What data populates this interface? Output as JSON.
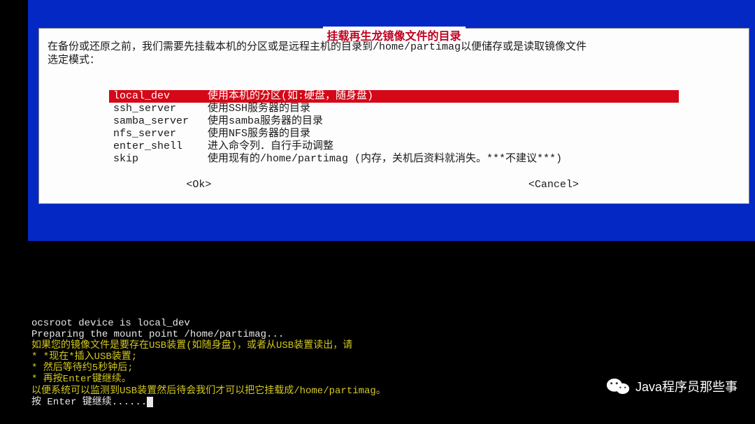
{
  "dialog": {
    "title": "挂载再生龙镜像文件的目录",
    "instructions_line1": "在备份或还原之前，我们需要先挂载本机的分区或是远程主机的目录到/home/partimag以便储存或是读取镜像文件",
    "instructions_line2": "选定模式：",
    "menu": [
      {
        "key": "local_dev",
        "desc": "使用本机的分区(如:硬盘，随身盘)",
        "selected": true
      },
      {
        "key": "ssh_server",
        "desc": "使用SSH服务器的目录",
        "selected": false
      },
      {
        "key": "samba_server",
        "desc": "使用samba服务器的目录",
        "selected": false
      },
      {
        "key": "nfs_server",
        "desc": "使用NFS服务器的目录",
        "selected": false
      },
      {
        "key": "enter_shell",
        "desc": "进入命令列．自行手动调整",
        "selected": false
      },
      {
        "key": "skip",
        "desc": "使用现有的/home/partimag (内存，关机后资料就消失。***不建议***)",
        "selected": false
      }
    ],
    "ok_label": "<Ok>",
    "cancel_label": "<Cancel>"
  },
  "terminal": {
    "line1": "ocsroot device is local_dev",
    "line2": "Preparing the mount point /home/partimag...",
    "line3": "如果您的镜像文件是要存在USB装置(如随身盘)，或者从USB装置读出，请",
    "line4": "* *现在*插入USB装置;",
    "line5": "* 然后等待约5秒钟后;",
    "line6": "* 再按Enter键继续。",
    "line7": "以便系统可以监测到USB装置然后待会我们才可以把它挂载成/home/partimag。",
    "line8": "按 Enter 键继续......"
  },
  "watermark": {
    "text": "Java程序员那些事"
  }
}
